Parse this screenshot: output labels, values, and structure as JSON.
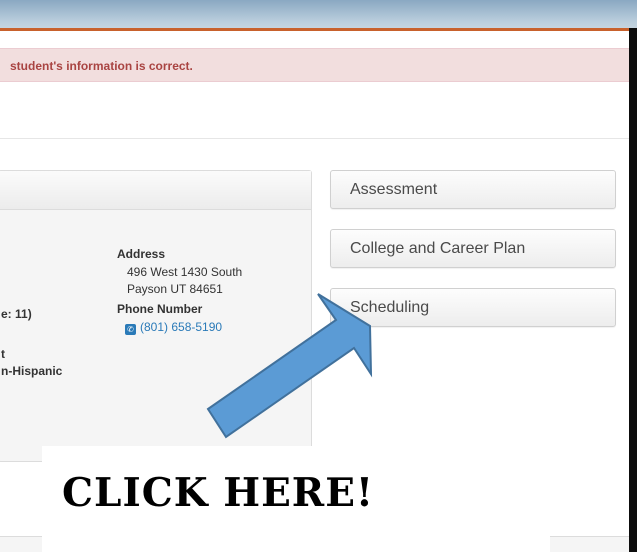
{
  "alert": {
    "text": "student's information is correct."
  },
  "student": {
    "grade_fragment": "e: 11)",
    "line_fragment_1": "t",
    "ethnicity_fragment": "n-Hispanic",
    "address_label": "Address",
    "address_line1": "496 West 1430 South",
    "address_line2": "Payson UT 84651",
    "phone_label": "Phone Number",
    "phone_number": "(801) 658-5190"
  },
  "side_menu": [
    {
      "label": "Assessment"
    },
    {
      "label": "College and Career Plan"
    },
    {
      "label": "Scheduling"
    }
  ],
  "callout": {
    "text": "CLICK HERE!"
  },
  "icons": {
    "phone": "phone-icon",
    "arrow": "arrow-icon"
  },
  "colors": {
    "alert_bg": "#f2dede",
    "alert_text": "#a94442",
    "link": "#2a7ab8",
    "accent_bar": "#c8612c",
    "arrow_fill": "#5b9bd5",
    "arrow_stroke": "#41719c"
  }
}
